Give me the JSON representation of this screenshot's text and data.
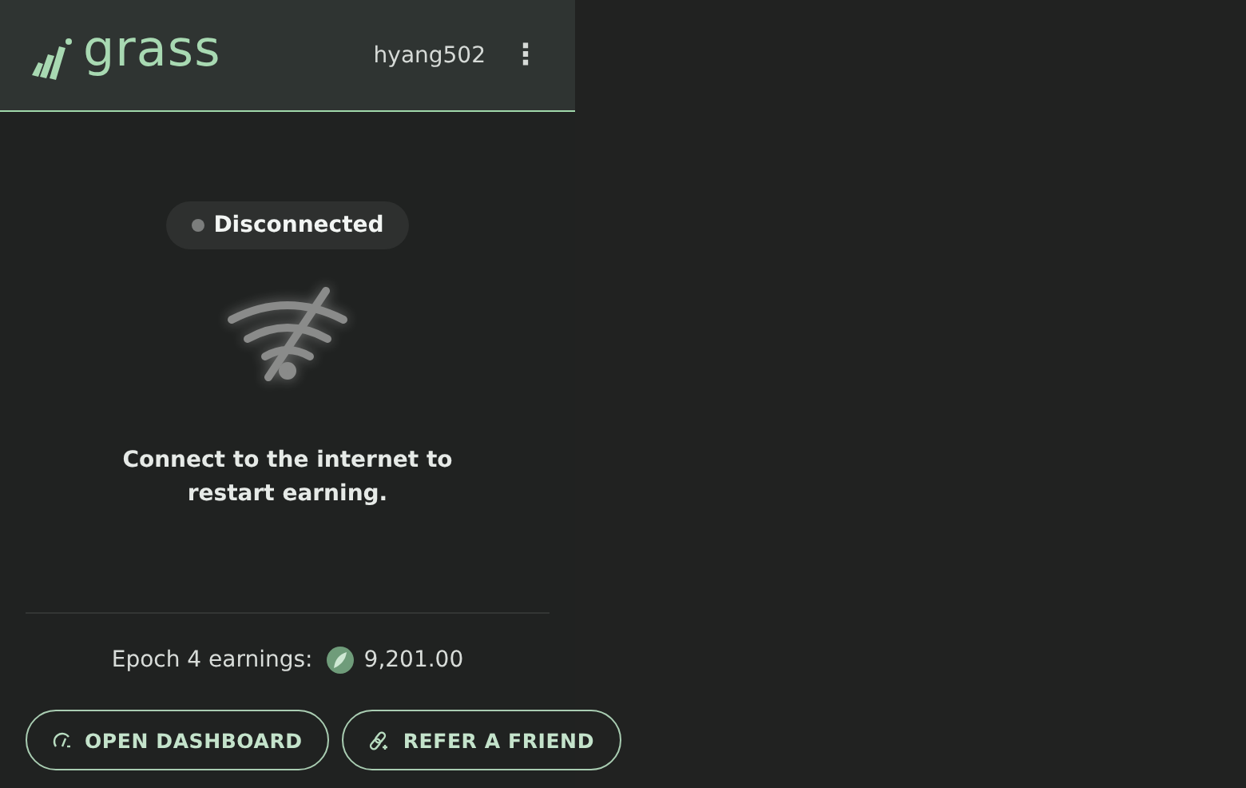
{
  "header": {
    "logo_text": "grass",
    "username": "hyang502",
    "menu_glyph": "⋮"
  },
  "status": {
    "label": "Disconnected",
    "connected": false
  },
  "message": "Connect to the internet to restart earning.",
  "earnings": {
    "label": "Epoch 4 earnings:",
    "amount": "9,201.00"
  },
  "buttons": [
    {
      "label": "OPEN DASHBOARD",
      "kind": "dashboard"
    },
    {
      "label": "REFER A FRIEND",
      "kind": "refer"
    }
  ]
}
